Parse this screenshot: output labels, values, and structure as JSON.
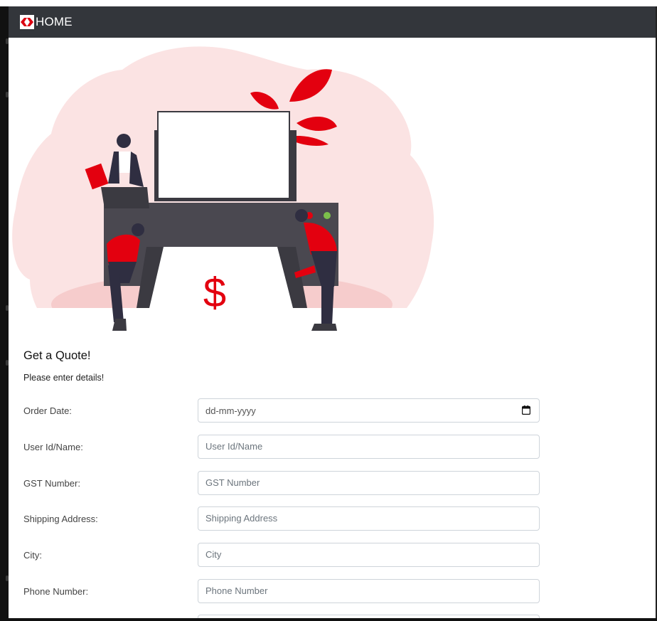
{
  "navbar": {
    "home_label": "HOME",
    "logo_icon": "hexagon-logo-icon",
    "background": "#33363b"
  },
  "hero": {
    "illustration": "team-moving-printer-illustration",
    "currency_symbol": "$",
    "accent": "#e3000f",
    "cloud_color": "#fbe3e3"
  },
  "form": {
    "title": "Get a Quote!",
    "subtitle": "Please enter details!",
    "fields": [
      {
        "label": "Order Date:",
        "value": "dd-mm-yyyy",
        "icon": "calendar-icon"
      },
      {
        "label": "User Id/Name:",
        "placeholder": "User Id/Name"
      },
      {
        "label": "GST Number:",
        "placeholder": "GST Number"
      },
      {
        "label": "Shipping Address:",
        "placeholder": "Shipping Address"
      },
      {
        "label": "City:",
        "placeholder": "City"
      },
      {
        "label": "Phone Number:",
        "placeholder": "Phone Number"
      }
    ]
  }
}
